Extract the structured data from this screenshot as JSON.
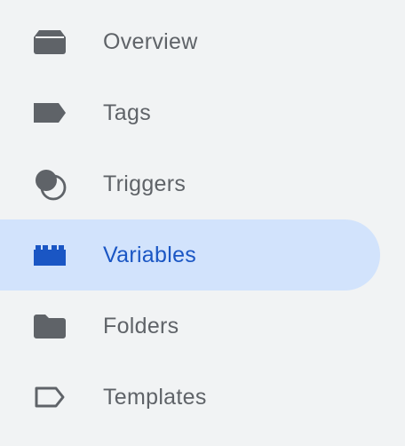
{
  "nav": {
    "items": [
      {
        "label": "Overview",
        "icon": "overview-icon",
        "active": false
      },
      {
        "label": "Tags",
        "icon": "tag-icon",
        "active": false
      },
      {
        "label": "Triggers",
        "icon": "trigger-icon",
        "active": false
      },
      {
        "label": "Variables",
        "icon": "variables-icon",
        "active": true
      },
      {
        "label": "Folders",
        "icon": "folder-icon",
        "active": false
      },
      {
        "label": "Templates",
        "icon": "template-icon",
        "active": false
      }
    ]
  },
  "colors": {
    "background": "#f1f3f4",
    "active_background": "#d2e3fc",
    "active_text": "#1a56c4",
    "text": "#5f6368",
    "icon": "#5f6368",
    "active_icon": "#1a56c4"
  }
}
